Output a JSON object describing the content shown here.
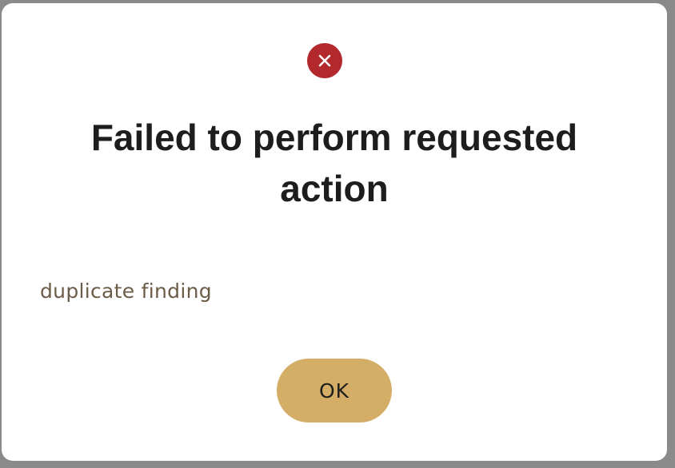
{
  "dialog": {
    "icon": "error-circle-x-icon",
    "title": "Failed to perform requested action",
    "message": "duplicate finding",
    "ok_label": "OK"
  },
  "colors": {
    "error": "#b3282d",
    "button": "#d4ad66",
    "message_text": "#6b5c48",
    "title_text": "#1d1d1d",
    "backdrop": "#8a8a8a"
  }
}
